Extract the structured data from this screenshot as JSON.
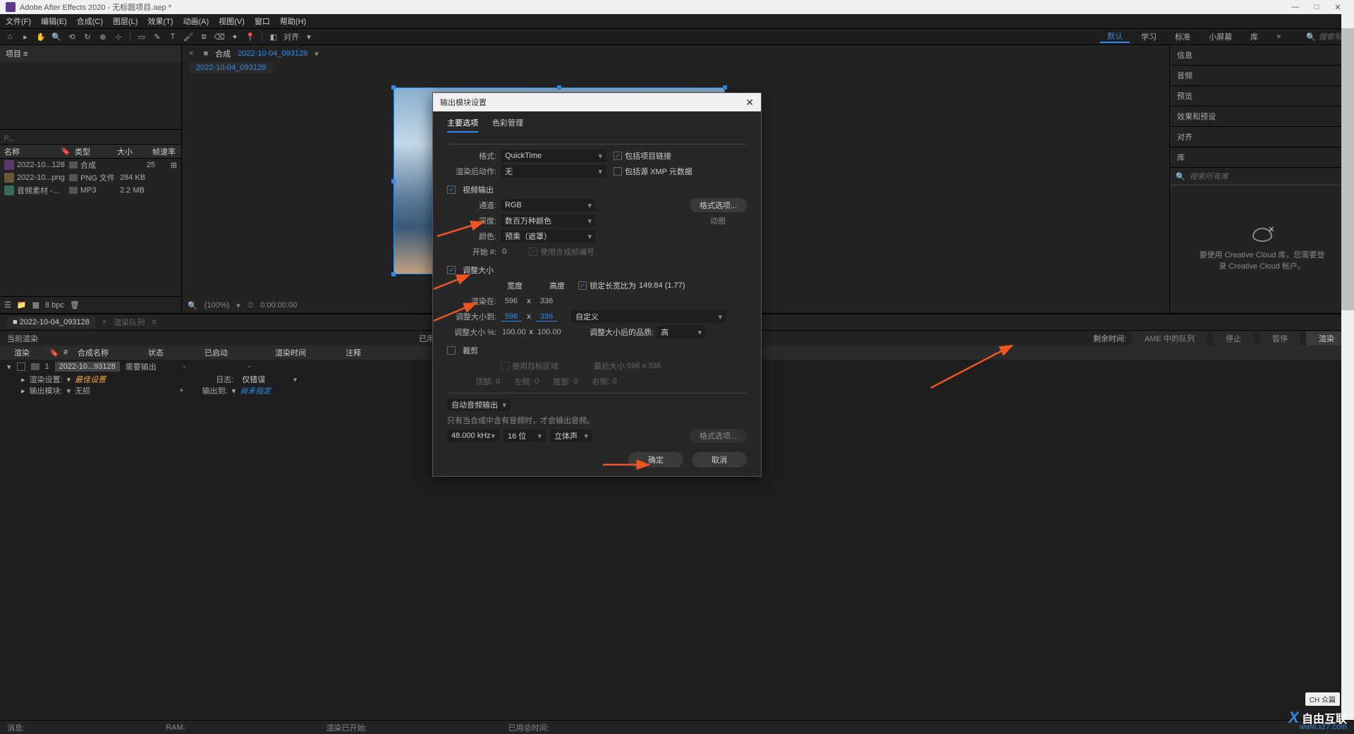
{
  "titlebar": {
    "title": "Adobe After Effects 2020 - 无标题项目.aep *"
  },
  "menubar": {
    "items": [
      "文件(F)",
      "编辑(E)",
      "合成(C)",
      "图层(L)",
      "效果(T)",
      "动画(A)",
      "视图(V)",
      "窗口",
      "帮助(H)"
    ]
  },
  "toolbar": {
    "align_label": "对齐",
    "workspaces": [
      "默认",
      "学习",
      "标准",
      "小屏幕",
      "库"
    ],
    "search_placeholder": "搜索帮助"
  },
  "project_panel": {
    "tab": "项目 ≡",
    "search_placeholder": "",
    "headers": {
      "name": "名称",
      "type": "类型",
      "size": "大小",
      "fps": "帧速率"
    },
    "items": [
      {
        "name": "2022-10...128",
        "type": "合成",
        "size": "25",
        "fps": ""
      },
      {
        "name": "2022-10...png",
        "type": "PNG 文件",
        "size": "284 KB",
        "fps": ""
      },
      {
        "name": "音频素材 -...",
        "type": "MP3",
        "size": "2.2 MB",
        "fps": ""
      }
    ],
    "bpc": "8 bpc"
  },
  "composition": {
    "tab_prefix": "合成",
    "tab_name": "2022-10-04_093128",
    "subtab": "2022-10-04_093128",
    "footer": {
      "zoom": "(100%)",
      "time": "0:00:00:00"
    }
  },
  "right_panels": {
    "items": [
      "信息",
      "音频",
      "预览",
      "效果和预设",
      "对齐",
      "库"
    ],
    "lib_search": "搜索所有库",
    "cc_msg1": "要使用 Creative Cloud 库，您需要登",
    "cc_msg2": "录 Creative Cloud 帐户。"
  },
  "timeline": {
    "tab1": "2022-10-04_093128",
    "tab2": "渲染队列",
    "current_render": "当前渲染",
    "elapsed": "已用时",
    "remaining": "剩余时间:",
    "btn_ame": "AME 中的队列",
    "btn_stop": "停止",
    "btn_pause": "暂停",
    "btn_render": "渲染",
    "cols": {
      "render": "渲染",
      "compname": "合成名称",
      "status": "状态",
      "started": "已启动",
      "rtime": "渲染时间",
      "comment": "注释"
    },
    "item": {
      "num": "1",
      "comp": "2022-10...93128",
      "status": "需要输出",
      "dash": "-",
      "rs_label": "渲染设置:",
      "rs_value": "最佳设置",
      "log_label": "日志:",
      "log_value": "仅错误",
      "om_label": "输出模块:",
      "om_value": "无损",
      "plus": "+",
      "out_label": "输出到:",
      "out_value": "尚未指定"
    }
  },
  "status": {
    "msg": "消息:",
    "ram": "RAM:",
    "rstart": "渲染已开始:",
    "total": "已用总时间:"
  },
  "dialog": {
    "title": "输出模块设置",
    "tab1": "主要选项",
    "tab2": "色彩管理",
    "format_label": "格式:",
    "format_value": "QuickTime",
    "include_link": "包括项目链接",
    "postrender_label": "渲染后动作:",
    "postrender_value": "无",
    "include_xmp": "包括源 XMP 元数据",
    "video_output": "视频输出",
    "channel_label": "通道:",
    "channel_value": "RGB",
    "format_opts": "格式选项...",
    "depth_label": "深度:",
    "depth_value": "数百万种颜色",
    "motion": "动图",
    "color_label": "颜色:",
    "color_value": "预乘（遮罩）",
    "start_label": "开始 #:",
    "start_value": "0",
    "use_comp_frame": "使用合成帧编号",
    "resize": "调整大小",
    "width_label": "宽度",
    "height_label": "高度",
    "lock_aspect": "锁定长宽比为",
    "aspect": "149:84 (1.77)",
    "render_at": "渲染在:",
    "render_w": "596",
    "render_h": "336",
    "x": "x",
    "resize_to": "调整大小到:",
    "resize_w": "596",
    "resize_h": "336",
    "resize_preset": "自定义",
    "resize_pct": "调整大小 %:",
    "pct_w": "100.00",
    "pct_h": "100.00",
    "resize_quality_label": "调整大小后的品质:",
    "resize_quality": "高",
    "crop": "裁剪",
    "use_roi": "使用目标区域",
    "final_size_label": "最后大小:",
    "final_size": "596 x 336",
    "top": "顶部:",
    "left": "左侧:",
    "bottom": "底部:",
    "right": "右侧:",
    "zero": "0",
    "audio_out": "自动音频输出",
    "audio_hint": "只有当合成中含有音频时，才会输出音频。",
    "sample_rate": "48.000 kHz",
    "bit_depth": "16 位",
    "channels": "立体声",
    "ok": "确定",
    "cancel": "取消"
  },
  "ime": "CH 众篇",
  "watermark": {
    "brand": "自由互联",
    "url": "www.xz7.com"
  }
}
